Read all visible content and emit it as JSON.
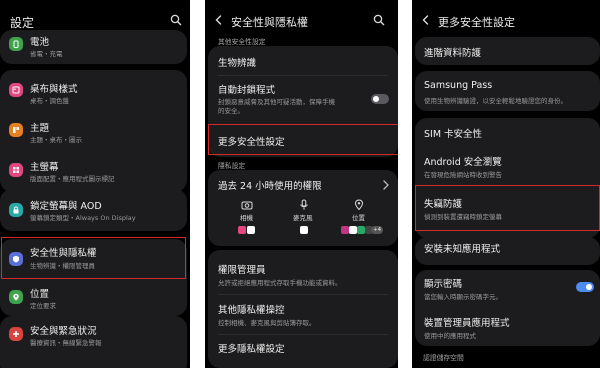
{
  "colors": {
    "icon_green": "#3fa34d",
    "icon_pink": "#e0487f",
    "icon_orange": "#e67e22",
    "icon_teal": "#2ba7a5",
    "icon_indigo": "#5b6fd8",
    "icon_blue": "#3a79d8",
    "icon_red": "#d6453f",
    "toggle_off": "#5a5a5e",
    "toggle_on": "#4f8cf0",
    "highlight": "#d42a2a"
  },
  "panel1": {
    "title": "設定",
    "items": [
      {
        "label": "電池",
        "sub": "省電・充電",
        "icon": "battery-icon"
      },
      {
        "label": "桌布與樣式",
        "sub": "桌布・調色盤",
        "icon": "palette-icon"
      },
      {
        "label": "主題",
        "sub": "主題・桌布・圖示",
        "icon": "theme-icon"
      },
      {
        "label": "主螢幕",
        "sub": "版面配置・應用程式圖示標記",
        "icon": "home-icon"
      },
      {
        "label": "鎖定螢幕與 AOD",
        "sub": "螢幕鎖定類型・Always On Display",
        "icon": "lock-icon"
      },
      {
        "label": "安全性與隱私權",
        "sub": "生物辨識・權限管理員",
        "icon": "shield-icon"
      },
      {
        "label": "位置",
        "sub": "定位要求",
        "icon": "location-icon"
      },
      {
        "label": "安全與緊急狀況",
        "sub": "醫療資訊・無線緊急警報",
        "icon": "emergency-icon"
      }
    ]
  },
  "panel2": {
    "title": "安全性與隱私權",
    "section_other": "其他安全性設定",
    "biometrics": "生物辨識",
    "autoblock_title": "自動封鎖程式",
    "autoblock_sub1": "封鎖惡意威脅及其他可疑活動，保障手機",
    "autoblock_sub2": "的安全。",
    "more_security": "更多安全性設定",
    "section_privacy": "隱私設定",
    "perms_title": "過去 24 小時使用的權限",
    "perm_camera": "相機",
    "perm_mic": "麥克風",
    "perm_location": "位置",
    "more_apps_badge": "+4",
    "perm_manager_title": "權限管理員",
    "perm_manager_sub": "允許或拒絕應用程式存取手機功能或資料。",
    "other_controls_title": "其他隱私權操控",
    "other_controls_sub": "控制相機、麥克風與剪貼簿存取。",
    "more_privacy": "更多隱私權設定"
  },
  "panel3": {
    "title": "更多安全性設定",
    "items": {
      "advanced_protection": "進階資料防護",
      "samsung_pass_title": "Samsung Pass",
      "samsung_pass_sub": "使用生物辨識驗證，以安全輕鬆地驗證您的身份。",
      "sim_security": "SIM 卡安全性",
      "safe_browsing_title": "Android 安全瀏覽",
      "safe_browsing_sub": "在發現危險網站時收到警告",
      "theft_title": "失竊防護",
      "theft_sub": "偵測到裝置遭竊時鎖定螢幕",
      "install_unknown": "安裝未知應用程式",
      "show_password_title": "顯示密碼",
      "show_password_sub": "當您輸入時顯示密碼字元。",
      "device_admin_title": "裝置管理員應用程式",
      "device_admin_sub": "使用中的應用程式",
      "section_credential": "認證儲存空間"
    }
  }
}
